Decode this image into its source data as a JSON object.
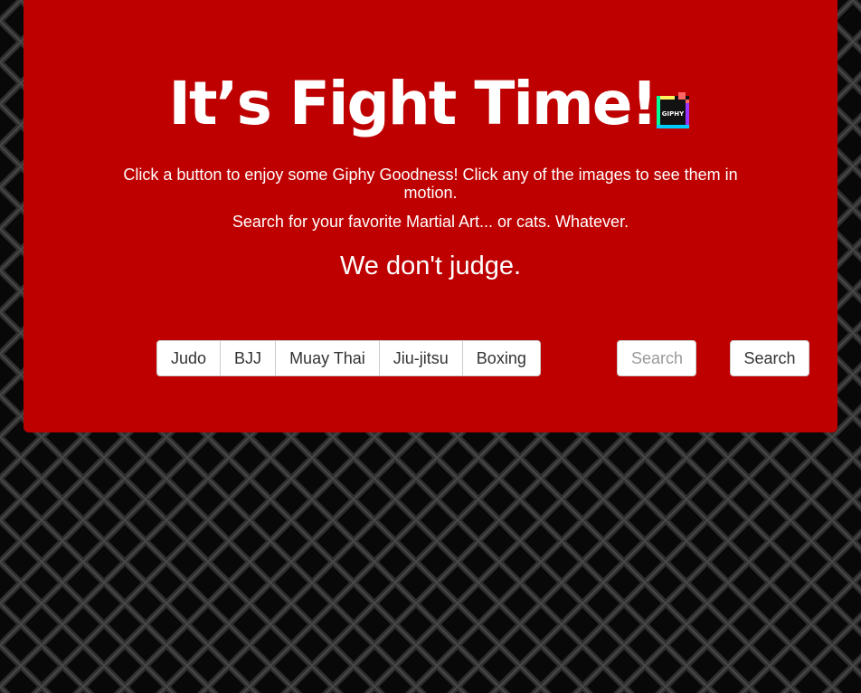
{
  "header": {
    "title": "It’s Fight Time!",
    "logo_icon": "giphy-logo-icon",
    "logo_text": "GIPHY"
  },
  "intro": {
    "line1": "Click a button to enjoy some Giphy Goodness! Click any of the images to see them in motion.",
    "line2": "Search for your favorite Martial Art... or cats. Whatever.",
    "tagline": "We don't judge."
  },
  "topics": {
    "buttons": [
      {
        "label": "Judo"
      },
      {
        "label": "BJJ"
      },
      {
        "label": "Muay Thai"
      },
      {
        "label": "Jiu-jitsu"
      },
      {
        "label": "Boxing"
      }
    ]
  },
  "search": {
    "placeholder": "Search",
    "value": "",
    "button_label": "Search"
  },
  "colors": {
    "panel": "#bf0000",
    "background": "#0b0b0b",
    "text": "#ffffff"
  }
}
